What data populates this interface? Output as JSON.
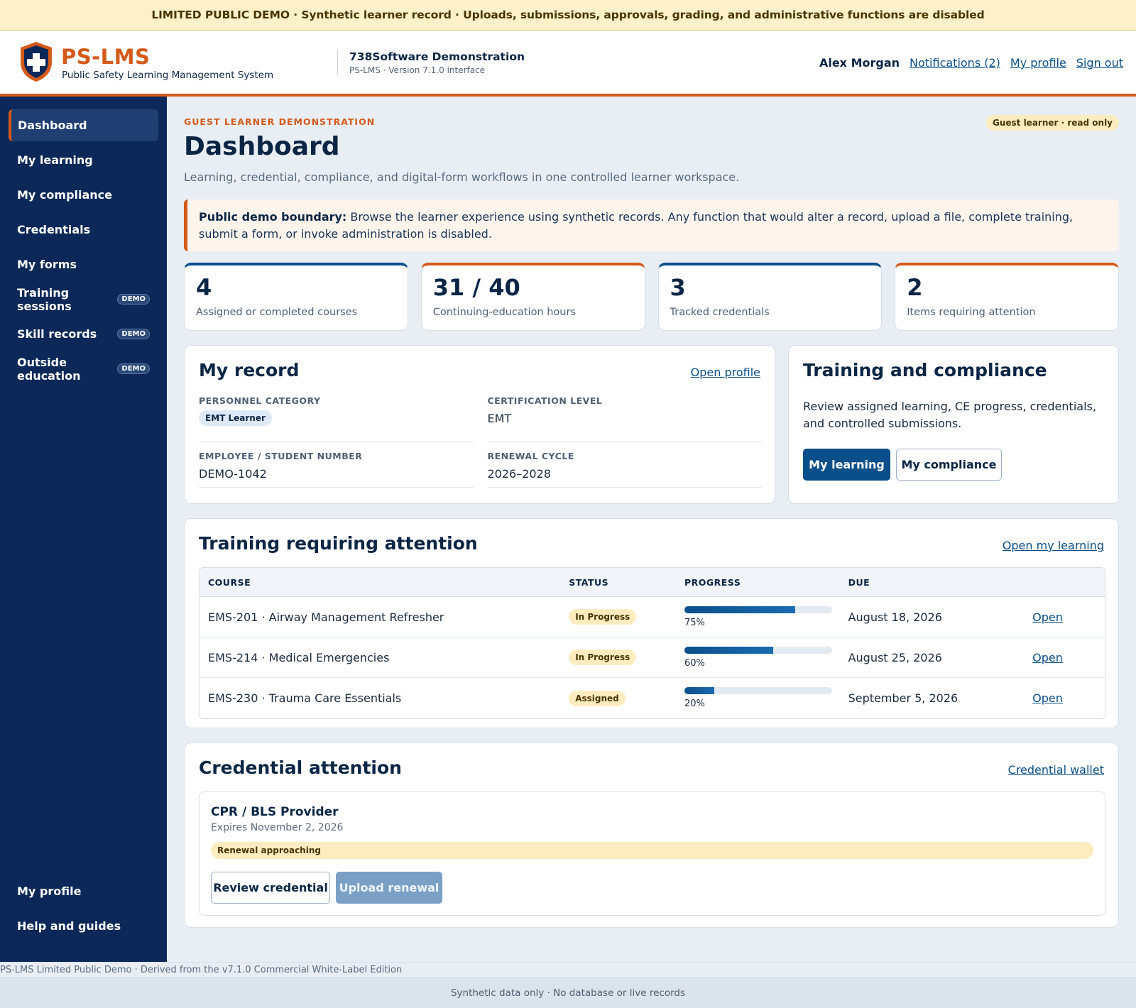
{
  "banner": "LIMITED PUBLIC DEMO · Synthetic learner record · Uploads, submissions, approvals, grading, and administrative functions are disabled",
  "brand": {
    "name": "PS-LMS",
    "subtitle": "Public Safety Learning Management System",
    "logo_icon": "shield-cross-icon"
  },
  "org": {
    "name": "738Software Demonstration",
    "version": "PS-LMS · Version 7.1.0 interface"
  },
  "header_nav": {
    "user": "Alex Morgan",
    "notifications": "Notifications (2)",
    "profile": "My profile",
    "signout": "Sign out"
  },
  "sidebar": {
    "items": [
      {
        "label": "Dashboard",
        "active": true
      },
      {
        "label": "My learning"
      },
      {
        "label": "My compliance"
      },
      {
        "label": "Credentials"
      },
      {
        "label": "My forms"
      },
      {
        "label": "Training sessions",
        "badge": "DEMO"
      },
      {
        "label": "Skill records",
        "badge": "DEMO"
      },
      {
        "label": "Outside education",
        "badge": "DEMO"
      }
    ],
    "bottom": [
      {
        "label": "My profile"
      },
      {
        "label": "Help and guides"
      }
    ]
  },
  "page": {
    "eyebrow": "GUEST LEARNER DEMONSTRATION",
    "role_badge": "Guest learner · read only",
    "title": "Dashboard",
    "subtitle": "Learning, credential, compliance, and digital-form workflows in one controlled learner workspace.",
    "notice_label": "Public demo boundary:",
    "notice_text": " Browse the learner experience using synthetic records. Any function that would alter a record, upload a file, complete training, submit a form, or invoke administration is disabled."
  },
  "stats": [
    {
      "value": "4",
      "label": "Assigned or completed courses"
    },
    {
      "value": "31 / 40",
      "label": "Continuing-education hours"
    },
    {
      "value": "3",
      "label": "Tracked credentials"
    },
    {
      "value": "2",
      "label": "Items requiring attention"
    }
  ],
  "record": {
    "title": "My record",
    "link": "Open profile",
    "personnel_label": "PERSONNEL CATEGORY",
    "personnel_value": "EMT Learner",
    "cert_label": "CERTIFICATION LEVEL",
    "cert_value": "EMT",
    "number_label": "EMPLOYEE / STUDENT NUMBER",
    "number_value": "DEMO-1042",
    "cycle_label": "RENEWAL CYCLE",
    "cycle_value": "2026–2028"
  },
  "training_compliance": {
    "title": "Training and compliance",
    "text": "Review assigned learning, CE progress, credentials, and controlled submissions.",
    "btn_learning": "My learning",
    "btn_compliance": "My compliance"
  },
  "training": {
    "title": "Training requiring attention",
    "link": "Open my learning",
    "headers": {
      "course": "COURSE",
      "status": "STATUS",
      "progress": "PROGRESS",
      "due": "DUE"
    },
    "rows": [
      {
        "course": "EMS-201 · Airway Management Refresher",
        "status": "In Progress",
        "progress": 75,
        "progress_label": "75%",
        "due": "August 18, 2026",
        "action": "Open"
      },
      {
        "course": "EMS-214 · Medical Emergencies",
        "status": "In Progress",
        "progress": 60,
        "progress_label": "60%",
        "due": "August 25, 2026",
        "action": "Open"
      },
      {
        "course": "EMS-230 · Trauma Care Essentials",
        "status": "Assigned",
        "progress": 20,
        "progress_label": "20%",
        "due": "September 5, 2026",
        "action": "Open"
      }
    ]
  },
  "credential": {
    "title": "Credential attention",
    "link": "Credential wallet",
    "name": "CPR / BLS Provider",
    "expires": "Expires November 2, 2026",
    "status": "Renewal approaching",
    "btn_review": "Review credential",
    "btn_upload": "Upload renewal"
  },
  "footer": {
    "line1": "PS-LMS Limited Public Demo · Derived from the v7.1.0 Commercial White-Label Edition",
    "line2": "Synthetic data only · No database or live records"
  },
  "colors": {
    "navy": "#0b2858",
    "accent_orange": "#d45a1a",
    "primary_blue": "#0b4f8a",
    "warning_bg": "#fdecc0"
  }
}
